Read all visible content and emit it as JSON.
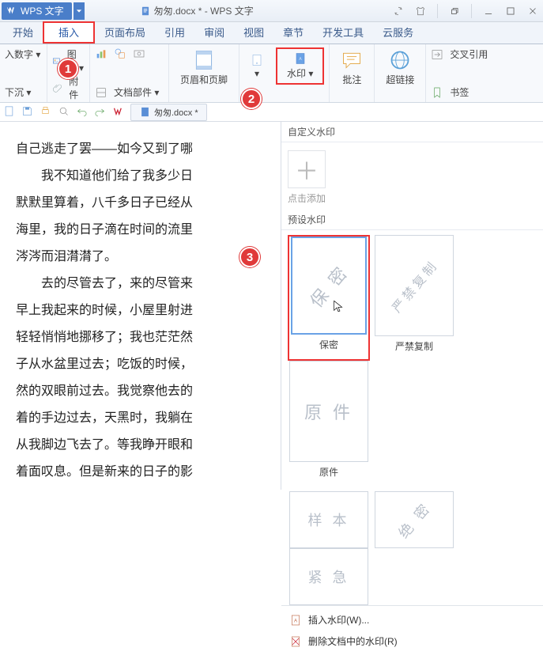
{
  "app": {
    "name": "WPS 文字",
    "doc_title": "匆匆.docx * - WPS 文字"
  },
  "tabs": [
    "开始",
    "插入",
    "页面布局",
    "引用",
    "审阅",
    "视图",
    "章节",
    "开发工具",
    "云服务"
  ],
  "tabs_selected_index": 1,
  "ribbon": {
    "g1_top": "入数字 ▾",
    "g1_bot": "下沉 ▾",
    "g2_top": "图片 ▾",
    "g2_bot": "附件",
    "g3_top": "文档部件 ▾",
    "pages": "页眉和页脚",
    "watermark": "水印 ▾",
    "comment": "批注",
    "hyperlink": "超链接",
    "crossref": "交叉引用",
    "bookmark": "书签"
  },
  "qat_doc_tab": "匆匆.docx *",
  "document_lines": [
    "自己逃走了罢——如今又到了哪",
    "我不知道他们给了我多少日",
    "默默里算着，八千多日子已经从",
    "海里，我的日子滴在时间的流里",
    "涔涔而泪潸潸了。",
    "去的尽管去了，来的尽管来",
    "早上我起来的时候，小屋里射进",
    "轻轻悄悄地挪移了；我也茫茫然",
    "子从水盆里过去；吃饭的时候，",
    "然的双眼前过去。我觉察他去的",
    "着的手边过去，天黑时，我躺在",
    "从我脚边飞去了。等我睁开眼和",
    "着面叹息。但是新来的日子的影"
  ],
  "panel": {
    "custom_title": "自定义水印",
    "add_label": "点击添加",
    "preset_title": "预设水印",
    "presets_row1": [
      {
        "wm": "保 密",
        "label": "保密"
      },
      {
        "wm": "严禁复制",
        "label": "严禁复制"
      },
      {
        "wm": "原 件",
        "label": "原件"
      }
    ],
    "presets_row2": [
      {
        "wm": "样 本",
        "label": ""
      },
      {
        "wm": "绝 密",
        "label": ""
      },
      {
        "wm": "紧 急",
        "label": ""
      }
    ],
    "menu_insert": "插入水印(W)...",
    "menu_remove": "删除文档中的水印(R)"
  },
  "callouts": {
    "c1": "1",
    "c2": "2",
    "c3": "3"
  }
}
